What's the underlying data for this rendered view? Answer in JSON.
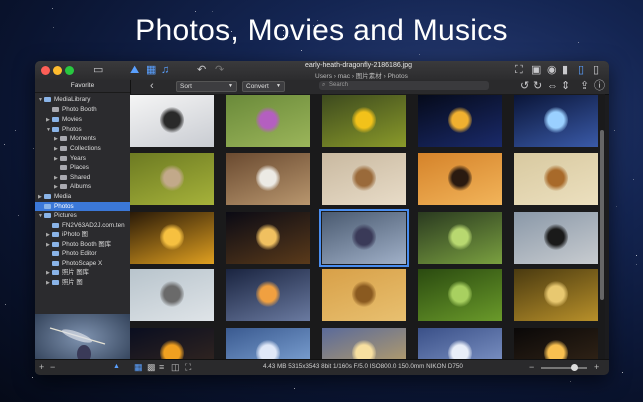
{
  "headline": "Photos, Movies and Musics",
  "window": {
    "filename": "early-heath-dragonfly-2186186.jpg",
    "path": "Users  ›  mac  ›  图片素材  ›  Photos"
  },
  "toolbar": {
    "sort_label": "Sort",
    "convert_label": "Convert",
    "search_placeholder": "Search"
  },
  "sidebar": {
    "title": "Favorite",
    "items": [
      {
        "label": "MediaLibrary"
      },
      {
        "label": "Photo Booth"
      },
      {
        "label": "Movies"
      },
      {
        "label": "Photos"
      },
      {
        "label": "Moments"
      },
      {
        "label": "Collections"
      },
      {
        "label": "Years"
      },
      {
        "label": "Places"
      },
      {
        "label": "Shared"
      },
      {
        "label": "Albums"
      },
      {
        "label": "Media"
      },
      {
        "label": "Photos"
      },
      {
        "label": "Pictures"
      },
      {
        "label": "FN2V63AD2J.com.ten"
      },
      {
        "label": "iPhoto 图"
      },
      {
        "label": "Photo Booth 图库"
      },
      {
        "label": "Photo Editor"
      },
      {
        "label": "PhotoScape X"
      },
      {
        "label": "照片 图库"
      },
      {
        "label": "照片 图"
      }
    ]
  },
  "status": {
    "info": "4.43 MB   5315x3543   8bit   1/160s   F/5.0   ISO800.0   150.0mm  NIKON D750"
  },
  "thumbnails": [
    "alarm clock",
    "thistle flower",
    "bee on sunflower",
    "city lights at night",
    "skyline at dusk",
    "cat in grass",
    "coffee and notebook",
    "crab on beach",
    "cat and dog silhouette",
    "dragonfly on reed",
    "golden leaves",
    "city at night",
    "dragonfly on flower",
    "frog figurine",
    "cyclist silhouette",
    "seashell on sand",
    "light trails",
    "desert dunes",
    "green leaves",
    "grass at sunset",
    "sunset",
    "mountain horizon",
    "sunlit clouds",
    "snowy peaks",
    "sparkler"
  ]
}
